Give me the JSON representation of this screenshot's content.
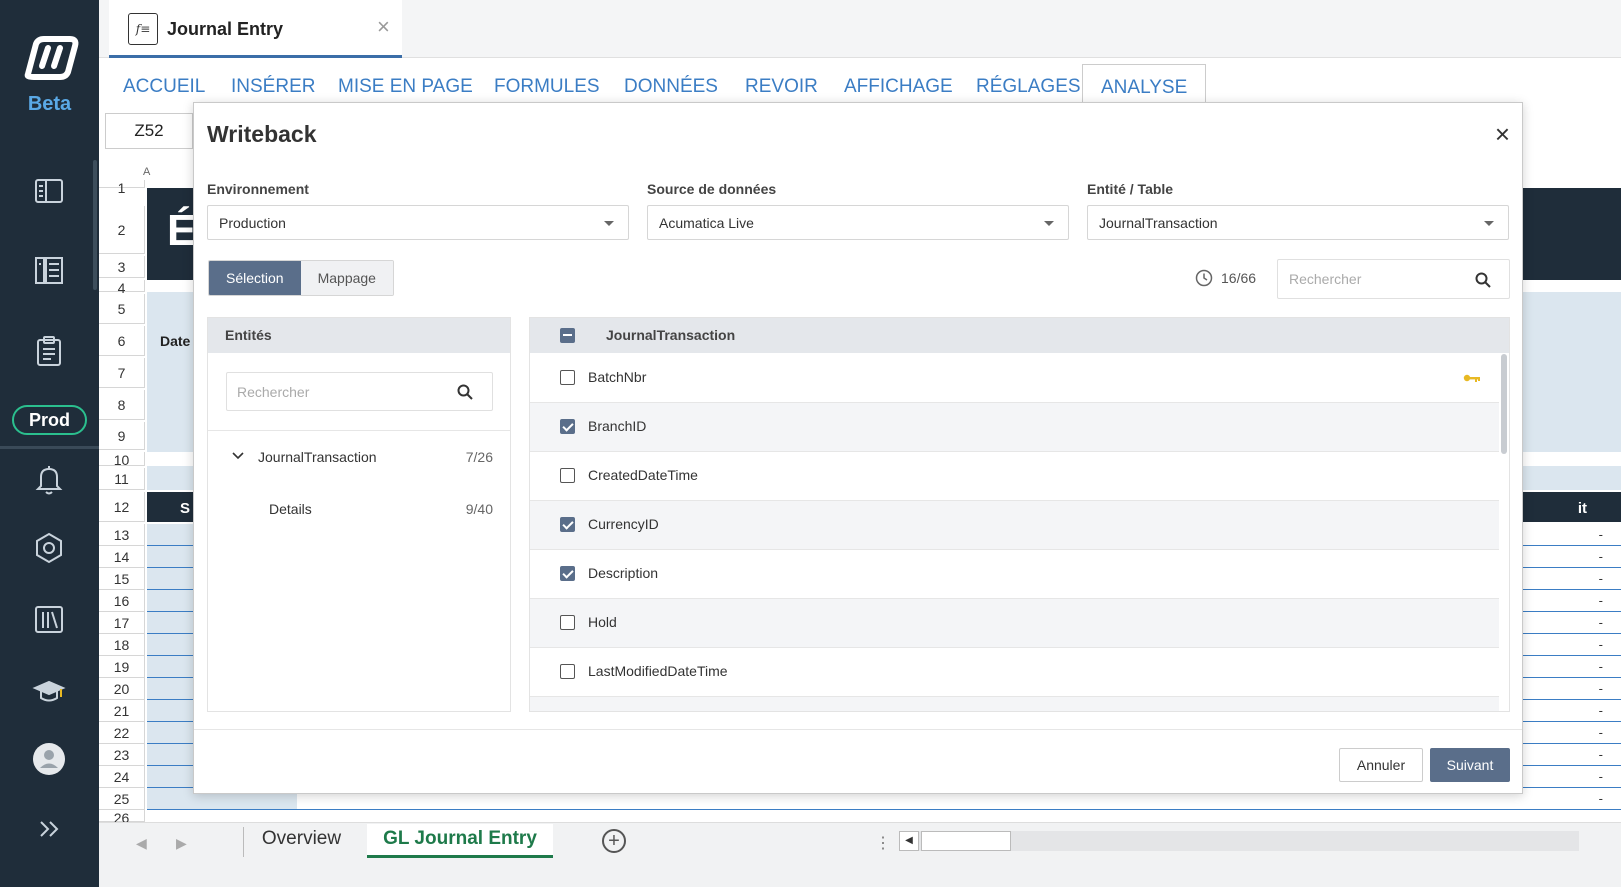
{
  "app": {
    "brand": "Beta",
    "environment_badge": "Prod"
  },
  "document_tab": {
    "title": "Journal Entry"
  },
  "ribbon": {
    "tabs": [
      "ACCUEIL",
      "INSÉRER",
      "MISE EN PAGE",
      "FORMULES",
      "DONNÉES",
      "REVOIR",
      "AFFICHAGE",
      "RÉGLAGES",
      "ANALYSE"
    ],
    "active": "ANALYSE"
  },
  "formula_bar": {
    "cell_ref": "Z52"
  },
  "sheet": {
    "row_numbers": [
      "1",
      "2",
      "3",
      "4",
      "5",
      "6",
      "7",
      "8",
      "9",
      "10",
      "11",
      "12",
      "13",
      "14",
      "15",
      "16",
      "17",
      "18",
      "19",
      "20",
      "21",
      "22",
      "23",
      "24",
      "25",
      "26"
    ],
    "col_a": "A",
    "title_fragment": "É",
    "date_label": "Date",
    "header_fragment_left": "S",
    "header_fragment_right": "it",
    "dash": "-"
  },
  "sheet_tabs": {
    "tabs": [
      "Overview",
      "GL Journal Entry"
    ],
    "active": "GL Journal Entry"
  },
  "modal": {
    "title": "Writeback",
    "environment": {
      "label": "Environnement",
      "value": "Production"
    },
    "datasource": {
      "label": "Source de données",
      "value": "Acumatica Live"
    },
    "entity_table": {
      "label": "Entité / Table",
      "value": "JournalTransaction"
    },
    "segments": {
      "selection": "Sélection",
      "mapping": "Mappage",
      "active": "Sélection"
    },
    "counter": "16/66",
    "search_placeholder": "Rechercher",
    "entities_panel": {
      "header": "Entités",
      "search_placeholder": "Rechercher",
      "tree": [
        {
          "label": "JournalTransaction",
          "count": "7/26",
          "expanded": true
        },
        {
          "label": "Details",
          "count": "9/40"
        }
      ]
    },
    "fields_panel": {
      "header": "JournalTransaction",
      "rows": [
        {
          "label": "BatchNbr",
          "checked": false,
          "key": true
        },
        {
          "label": "BranchID",
          "checked": true
        },
        {
          "label": "CreatedDateTime",
          "checked": false
        },
        {
          "label": "CurrencyID",
          "checked": true
        },
        {
          "label": "Description",
          "checked": true
        },
        {
          "label": "Hold",
          "checked": false
        },
        {
          "label": "LastModifiedDateTime",
          "checked": false
        }
      ]
    },
    "buttons": {
      "cancel": "Annuler",
      "next": "Suivant"
    }
  },
  "colors": {
    "sidebar_bg": "#1f2d3a",
    "accent_blue": "#3b7dc4",
    "prod_green": "#2bbf8e",
    "primary_button": "#5a6e8a",
    "active_sheet_tab": "#1e7a4a",
    "key_icon": "#e8b923"
  }
}
